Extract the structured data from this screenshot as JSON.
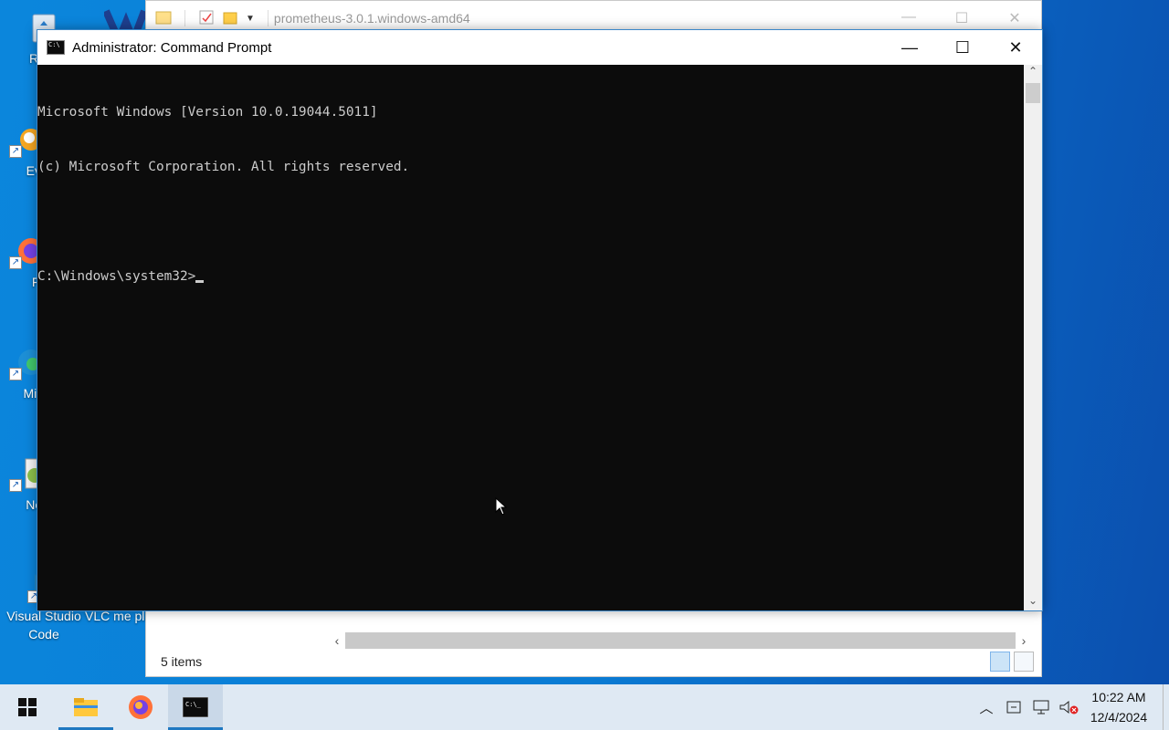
{
  "desktop": {
    "icons": [
      {
        "label": "Recy",
        "icon": "recycle-bin-icon"
      },
      {
        "label": "Ever",
        "icon": "everything-icon"
      },
      {
        "label": "Fir",
        "icon": "firefox-icon"
      },
      {
        "label": "Mic E",
        "icon": "edge-icon"
      },
      {
        "label": "Note",
        "icon": "notepadpp-icon"
      },
      {
        "label": "Visual Studio Code",
        "icon": "vscode-icon"
      },
      {
        "label": "VLC me playe",
        "icon": "vlc-icon"
      }
    ]
  },
  "explorer": {
    "title": "prometheus-3.0.1.windows-amd64",
    "status": "5 items"
  },
  "cmd": {
    "title": "Administrator: Command Prompt",
    "lines": [
      "Microsoft Windows [Version 10.0.19044.5011]",
      "(c) Microsoft Corporation. All rights reserved.",
      "",
      "C:\\Windows\\system32>"
    ],
    "minimize": "—",
    "maximize": "☐",
    "close": "✕"
  },
  "taskbar": {
    "apps": [
      {
        "name": "start",
        "icon": "windows-logo-icon"
      },
      {
        "name": "file-explorer",
        "icon": "folder-icon"
      },
      {
        "name": "firefox",
        "icon": "firefox-icon"
      },
      {
        "name": "command-prompt",
        "icon": "cmd-icon"
      }
    ],
    "clock": {
      "time": "10:22 AM",
      "date": "12/4/2024"
    }
  },
  "colors": {
    "console_bg": "#0c0c0c",
    "console_fg": "#cccccc",
    "taskbar_bg": "#dfe9f3",
    "accent": "#1f78c1"
  }
}
